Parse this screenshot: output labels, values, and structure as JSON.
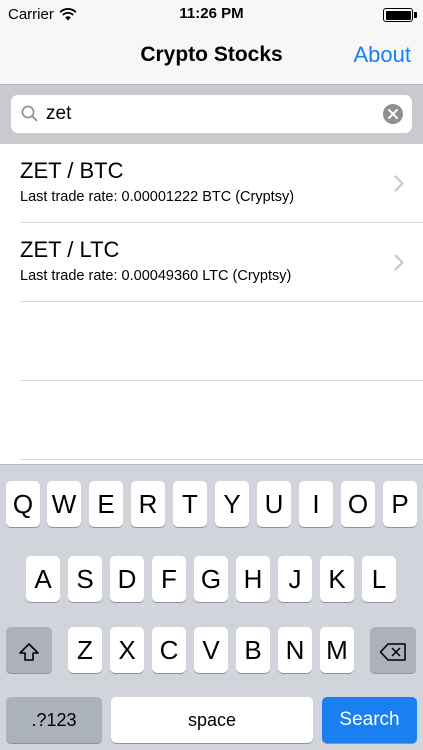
{
  "status_bar": {
    "carrier": "Carrier",
    "time": "11:26 PM"
  },
  "nav": {
    "title": "Crypto Stocks",
    "about_label": "About"
  },
  "search": {
    "value": "zet"
  },
  "results": [
    {
      "title": "ZET / BTC",
      "subtitle": "Last trade rate: 0.00001222 BTC (Cryptsy)"
    },
    {
      "title": "ZET / LTC",
      "subtitle": "Last trade rate: 0.00049360 LTC (Cryptsy)"
    }
  ],
  "keyboard": {
    "row1": [
      "Q",
      "W",
      "E",
      "R",
      "T",
      "Y",
      "U",
      "I",
      "O",
      "P"
    ],
    "row2": [
      "A",
      "S",
      "D",
      "F",
      "G",
      "H",
      "J",
      "K",
      "L"
    ],
    "row3": [
      "Z",
      "X",
      "C",
      "V",
      "B",
      "N",
      "M"
    ],
    "numbers_label": ".?123",
    "space_label": "space",
    "search_label": "Search"
  },
  "colors": {
    "accent": "#1a80f2",
    "keyboard_bg": "#d1d5db",
    "function_key": "#abb2bb"
  },
  "icons": [
    "wifi-icon",
    "battery-icon",
    "search-icon",
    "clear-icon",
    "chevron-right-icon",
    "shift-icon",
    "backspace-icon"
  ]
}
